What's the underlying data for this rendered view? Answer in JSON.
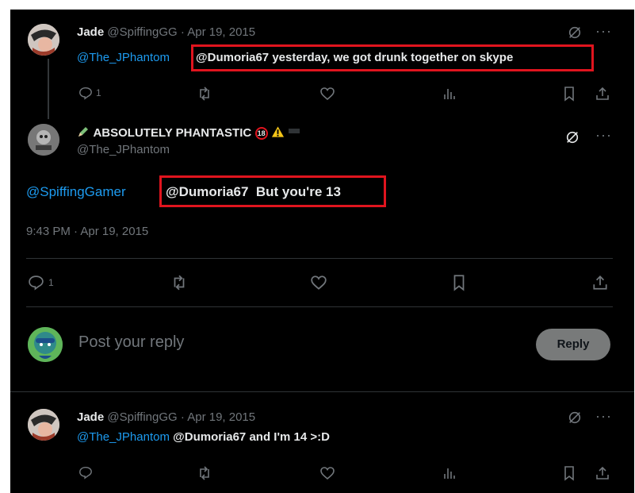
{
  "tweet1": {
    "name": "Jade",
    "handle": "@SpiffingGG",
    "dot": "·",
    "date": "Apr 19, 2015",
    "mention": "@The_JPhantom",
    "text": "@Dumoria67 yesterday, we got drunk together on skype",
    "reply_count": "1",
    "more_label": "···"
  },
  "main_tweet": {
    "name": "ABSOLUTELY PHANTASTIC",
    "age_badge": "18",
    "handle": "@The_JPhantom",
    "mention": "@SpiffingGamer",
    "text": "@Dumoria67  But you're 13",
    "timestamp": "9:43 PM · Apr 19, 2015",
    "reply_count": "1",
    "more_label": "···"
  },
  "composer": {
    "placeholder": "Post your reply",
    "reply_button": "Reply"
  },
  "tweet3": {
    "name": "Jade",
    "handle": "@SpiffingGG",
    "dot": "·",
    "date": "Apr 19, 2015",
    "mention": "@The_JPhantom",
    "text": "@Dumoria67 and I'm 14 >:D",
    "more_label": "···"
  },
  "icons": [
    "reply-icon",
    "retweet-icon",
    "like-icon",
    "views-icon",
    "bookmark-icon",
    "share-icon",
    "grok-icon",
    "more-icon",
    "warning-icon",
    "pencil-emoji-icon"
  ],
  "colors": {
    "background": "#000000",
    "link": "#1d9bf0",
    "muted": "#71767b",
    "highlight": "#e0141e",
    "divider": "#2f3336"
  }
}
